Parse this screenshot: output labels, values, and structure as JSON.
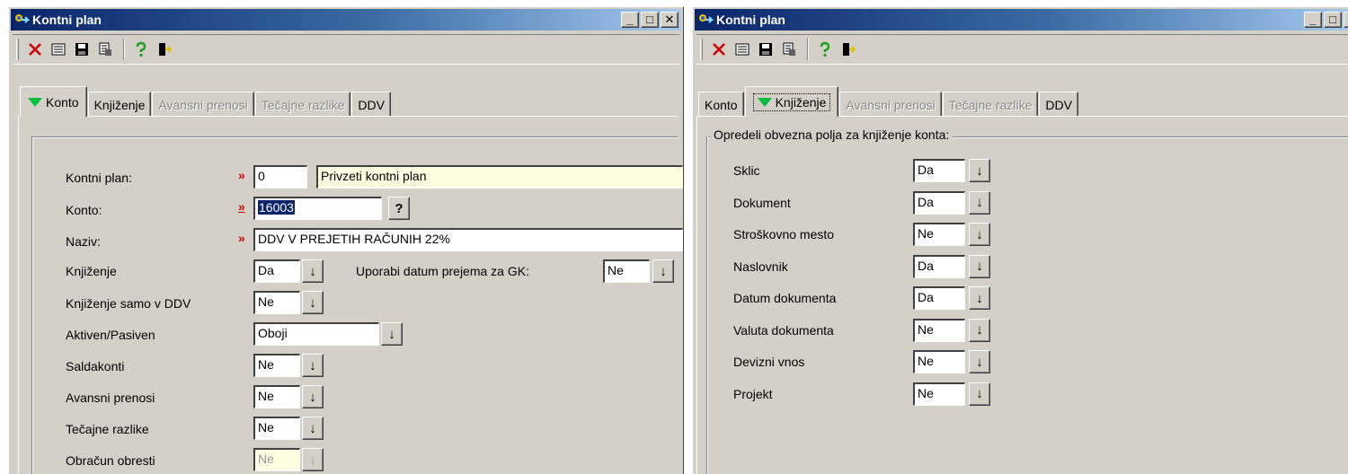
{
  "left": {
    "title": "Kontni plan",
    "caption": {
      "minimize": "_",
      "maximize": "□",
      "close": "✕"
    },
    "tabs": [
      "Konto",
      "Knjiženje",
      "Avansni prenosi",
      "Tečajne razlike",
      "DDV"
    ],
    "fields": {
      "kontni_plan_label": "Kontni plan:",
      "kontni_plan_value": "0",
      "kontni_plan_name": "Privzeti kontni plan",
      "konto_label": "Konto:",
      "konto_value": "16003",
      "konto_help": "?",
      "naziv_label": "Naziv:",
      "naziv_value": "DDV V PREJETIH RAČUNIH 22%",
      "knjizenje_label": "Knjiženje",
      "knjizenje_value": "Da",
      "uporabi_label": "Uporabi datum prejema za GK:",
      "uporabi_value": "Ne",
      "samo_ddv_label": "Knjiženje samo v DDV",
      "samo_ddv_value": "Ne",
      "aktiven_label": "Aktiven/Pasiven",
      "aktiven_value": "Oboji",
      "saldakonti_label": "Saldakonti",
      "saldakonti_value": "Ne",
      "avansni_label": "Avansni prenosi",
      "avansni_value": "Ne",
      "tecajne_label": "Tečajne razlike",
      "tecajne_value": "Ne",
      "obracun_label": "Obračun obresti",
      "obracun_value": "Ne"
    },
    "req_marker": "»",
    "dd_arrow": "↓"
  },
  "right": {
    "title": "Kontni plan",
    "caption": {
      "minimize": "_",
      "maximize": "□",
      "close": "✕"
    },
    "tabs": [
      "Konto",
      "Knjiženje",
      "Avansni prenosi",
      "Tečajne razlike",
      "DDV"
    ],
    "group_title": "Opredeli obvezna polja za knjiženje konta:",
    "rows": [
      {
        "label": "Sklic",
        "value": "Da"
      },
      {
        "label": "Dokument",
        "value": "Da"
      },
      {
        "label": "Stroškovno mesto",
        "value": "Ne"
      },
      {
        "label": "Naslovnik",
        "value": "Da"
      },
      {
        "label": "Datum dokumenta",
        "value": "Da"
      },
      {
        "label": "Valuta dokumenta",
        "value": "Ne"
      },
      {
        "label": "Devizni vnos",
        "value": "Ne"
      },
      {
        "label": "Projekt",
        "value": "Ne"
      }
    ],
    "dd_arrow": "↓"
  },
  "icons": [
    "delete-icon",
    "list-icon",
    "save-icon",
    "print-icon",
    "help-icon",
    "exit-icon"
  ]
}
